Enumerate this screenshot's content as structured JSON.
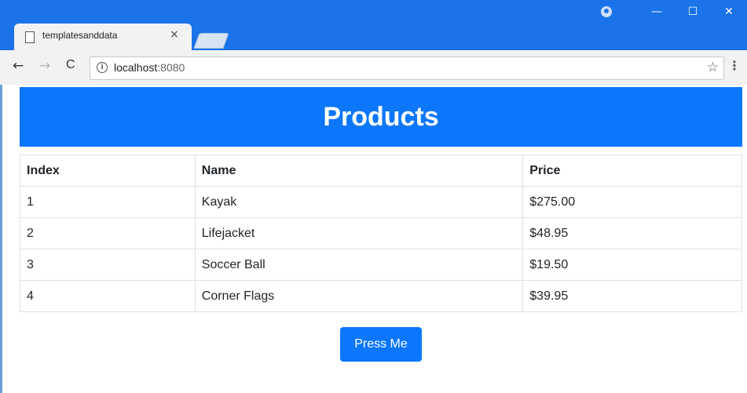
{
  "browser": {
    "tab": {
      "title": "templatesanddata",
      "close_glyph": "×",
      "page_icon": "page-icon"
    },
    "new_tab_icon": "new-tab-icon",
    "window_controls": {
      "profile_icon": "profile-icon",
      "minimize": "—",
      "maximize": "☐",
      "close": "✕"
    },
    "toolbar": {
      "back": "←",
      "forward": "→",
      "reload": "C",
      "info_glyph": "i",
      "url_host": "localhost",
      "url_port": ":8080",
      "star": "☆",
      "menu": "⋮"
    }
  },
  "page": {
    "title": "Products",
    "table": {
      "headers": [
        "Index",
        "Name",
        "Price"
      ],
      "rows": [
        [
          "1",
          "Kayak",
          "$275.00"
        ],
        [
          "2",
          "Lifejacket",
          "$48.95"
        ],
        [
          "3",
          "Soccer Ball",
          "$19.50"
        ],
        [
          "4",
          "Corner Flags",
          "$39.95"
        ]
      ]
    },
    "button_label": "Press Me"
  },
  "colors": {
    "accent": "#0d77fc",
    "titlebar": "#1a73e8"
  }
}
